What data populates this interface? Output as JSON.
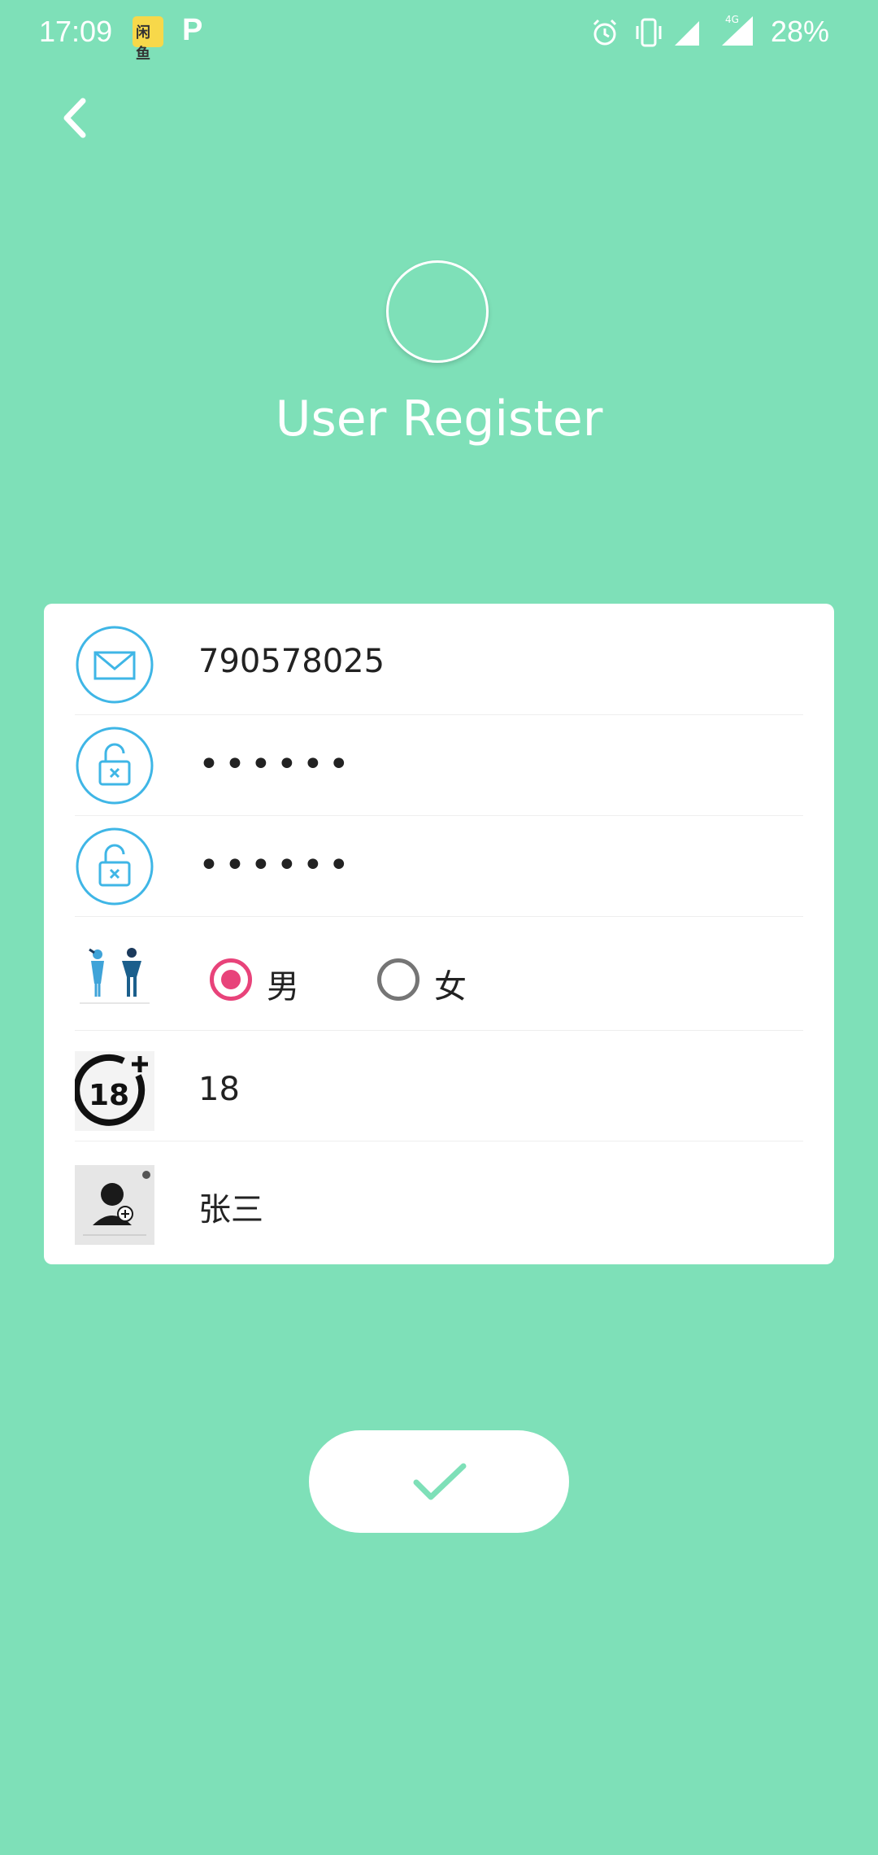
{
  "status_bar": {
    "time": "17:09",
    "battery": "28%",
    "network": "4G",
    "notification_app_label": "闲鱼",
    "notification_p": "P"
  },
  "header": {
    "title": "User Register"
  },
  "form": {
    "email_value": "790578025",
    "password_value": "••••••",
    "confirm_password_value": "••••••",
    "gender_options": [
      {
        "label": "男",
        "checked": true
      },
      {
        "label": "女",
        "checked": false
      }
    ],
    "age_value": "18",
    "name_value": "张三"
  },
  "colors": {
    "background": "#7ee0b8",
    "accent_pink": "#e8437a",
    "icon_blue": "#3fb6e6",
    "check_green": "#7ee0b8"
  },
  "icons": {
    "email": "mail-icon",
    "password": "unlock-icon",
    "confirm_password": "unlock-icon",
    "gender": "gender-icon",
    "age": "age-18-plus-icon",
    "name": "user-add-icon",
    "submit": "check-icon",
    "back": "chevron-left-icon"
  }
}
